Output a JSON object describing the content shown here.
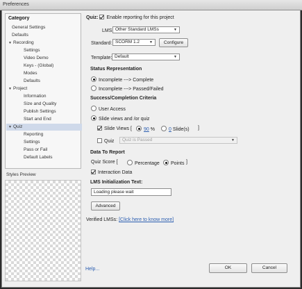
{
  "window": {
    "title": "Preferences"
  },
  "category": {
    "heading": "Category",
    "items": [
      {
        "label": "General Settings",
        "level": 0
      },
      {
        "label": "Defaults",
        "level": 0
      },
      {
        "label": "Recording",
        "level": 0,
        "expander": "expanded"
      },
      {
        "label": "Settings",
        "level": 1
      },
      {
        "label": "Video Demo",
        "level": 1
      },
      {
        "label": "Keys - (Global)",
        "level": 1
      },
      {
        "label": "Modes",
        "level": 1
      },
      {
        "label": "Defaults",
        "level": 1
      },
      {
        "label": "Project",
        "level": 0,
        "expander": "expanded"
      },
      {
        "label": "Information",
        "level": 1
      },
      {
        "label": "Size and Quality",
        "level": 1
      },
      {
        "label": "Publish Settings",
        "level": 1
      },
      {
        "label": "Start and End",
        "level": 1
      },
      {
        "label": "Quiz",
        "level": 0,
        "expander": "expanded",
        "selected": true
      },
      {
        "label": "Reporting",
        "level": 1
      },
      {
        "label": "Settings",
        "level": 1
      },
      {
        "label": "Pass or Fail",
        "level": 1
      },
      {
        "label": "Default Labels",
        "level": 1
      }
    ],
    "styles_preview_label": "Styles Preview"
  },
  "quiz_reporting": {
    "quiz_label": "Quiz:",
    "enable_reporting_label": "Enable reporting for this project",
    "enable_reporting_checked": true,
    "lms_label": "LMS:",
    "lms_value": "Other Standard LMSs",
    "standard_label": "Standard:",
    "standard_value": "SCORM 1.2",
    "configure_label": "Configure",
    "template_label": "Template:",
    "template_value": "Default",
    "status_heading": "Status Representation",
    "status_options": [
      {
        "label": "Incomplete ---> Complete",
        "checked": true
      },
      {
        "label": "Incomplete ---> Passed/Failed",
        "checked": false
      }
    ],
    "criteria_heading": "Success/Completion Criteria",
    "criteria_options": [
      {
        "label": "User Access",
        "checked": false
      },
      {
        "label": "Slide views and /or quiz",
        "checked": true
      }
    ],
    "slide_views_label": "Slide Views [",
    "slide_views_checked": true,
    "percent_value": "90",
    "percent_label": "%",
    "percent_checked": true,
    "slides_value": "0",
    "slides_label": "Slide(s)",
    "slides_checked": false,
    "bracket_close": "]",
    "quiz_check_label": "Quiz",
    "quiz_check_checked": false,
    "quiz_dropdown_value": "Quiz is Passed",
    "data_heading": "Data To Report",
    "quiz_score_label": "Quiz Score  [",
    "score_options": [
      {
        "label": "Percentage",
        "checked": false
      },
      {
        "label": "Points",
        "checked": true
      }
    ],
    "score_bracket_close": "]",
    "interaction_label": "Interaction Data",
    "interaction_checked": true,
    "init_heading": "LMS Initialization Text:",
    "init_value": "Loading please wait",
    "advanced_label": "Advanced",
    "verified_label": "Verified LMSs:",
    "verified_link": "[Click here to know more]"
  },
  "footer": {
    "help_label": "Help...",
    "ok_label": "OK",
    "cancel_label": "Cancel"
  },
  "colors": {
    "selection": "#cfd9ea",
    "link": "#2a5db0",
    "dialog_bg": "#efefef"
  }
}
